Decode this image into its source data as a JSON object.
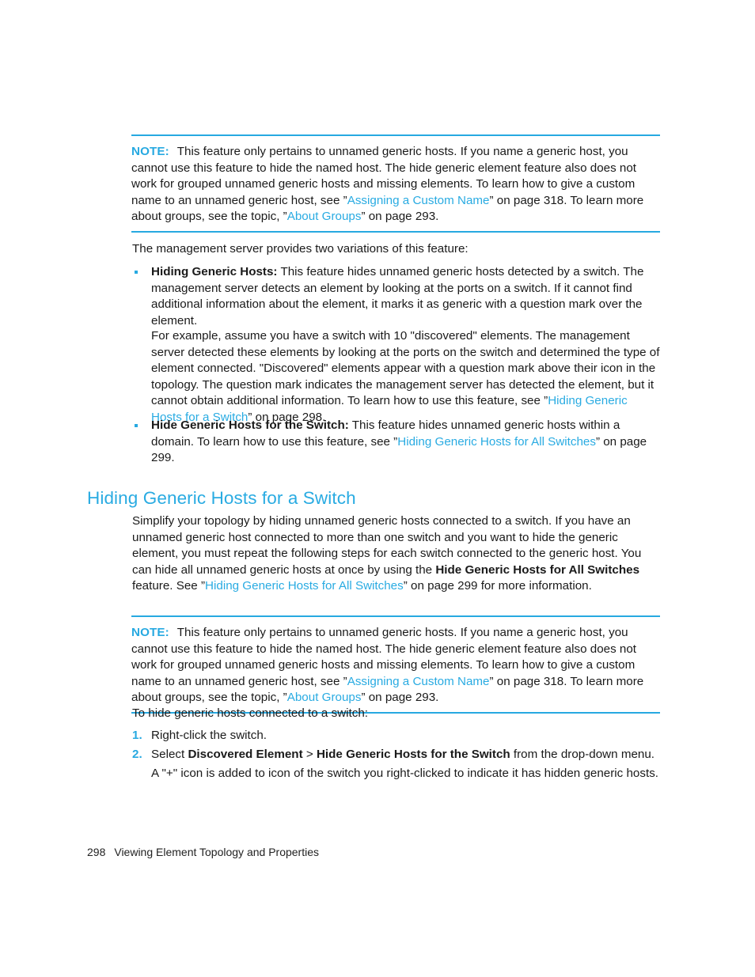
{
  "colors": {
    "accent": "#29abe2",
    "rule": "#27a9e1",
    "text": "#1a1a1a",
    "page_bg": "#ffffff"
  },
  "note_1": {
    "label": "NOTE:",
    "text_1": "This feature only pertains to unnamed generic hosts. If you name a generic host, you cannot use this feature to hide the named host. The hide generic element feature also does not work for grouped unnamed generic hosts and missing elements. To learn how to give a custom name to an unnamed generic host, see ”",
    "link_1": "Assigning a Custom Name",
    "text_2": "” on page 318. To learn more about groups, see the topic, ”",
    "link_2": "About Groups",
    "text_3": "” on page 293."
  },
  "intro": {
    "text": "The management server provides two variations of this feature:"
  },
  "bullets": [
    {
      "marker": "bullet-dot",
      "bold_lead": "Hiding Generic Hosts:",
      "text": " This feature hides unnamed generic hosts detected by a switch. The management server detects an element by looking at the ports on a switch. If it cannot find additional information about the element, it marks it as generic with a question mark over the element."
    },
    {
      "marker": "bullet-dot",
      "bold_lead": "Hide Generic Hosts for the Switch:",
      "text_1": " This feature hides unnamed generic hosts within a domain. To learn how to use this feature, see ”",
      "link_1": "Hiding Generic Hosts for All Switches",
      "text_2": "” on page 299."
    }
  ],
  "example_para": {
    "text_1": "For example, assume you have a switch with 10 \"discovered\" elements. The management server detected these elements by looking at the ports on the switch and determined the type of element connected. \"Discovered\" elements appear with a question mark above their icon in the topology. The question mark indicates the management server has detected the element, but it cannot obtain additional information. To learn how to use this feature, see ”",
    "link_1": "Hiding Generic Hosts for a Switch",
    "text_2": "” on page 298."
  },
  "section": {
    "heading": "Hiding Generic Hosts for a Switch",
    "para_text_1": "Simplify your topology by hiding unnamed generic hosts connected to a switch. If you have an unnamed generic host connected to more than one switch and you want to hide the generic element, you must repeat the following steps for each switch connected to the generic host. You can hide all unnamed generic hosts at once by using the ",
    "para_bold_1": "Hide Generic Hosts for All Switches",
    "para_text_2": " feature. See ”",
    "para_link_1": "Hiding Generic Hosts for All Switches",
    "para_text_3": "” on page 299 for more information."
  },
  "note_2": {
    "label": "NOTE:",
    "text_1": "This feature only pertains to unnamed generic hosts. If you name a generic host, you cannot use this feature to hide the named host. The hide generic element feature also does not work for grouped unnamed generic hosts and missing elements. To learn how to give a custom name to an unnamed generic host, see ”",
    "link_1": "Assigning a Custom Name",
    "text_2": "” on page 318. To learn more about groups, see the topic, ”",
    "link_2": "About Groups",
    "text_3": "” on page 293."
  },
  "procedure": {
    "lead_in": "To hide generic hosts connected to a switch:",
    "steps": [
      {
        "marker": "1.",
        "text": "Right-click the switch."
      },
      {
        "marker": "2.",
        "text_1": "Select ",
        "bold_1": "Discovered Element",
        "text_2": " > ",
        "bold_2": "Hide Generic Hosts for the Switch",
        "text_3": " from the drop-down menu.",
        "note_text": "A \"+\" icon is added to icon of the switch you right-clicked to indicate it has hidden generic hosts."
      }
    ]
  },
  "footer": {
    "page_number": "298",
    "chapter_title": "Viewing Element Topology and Properties"
  }
}
